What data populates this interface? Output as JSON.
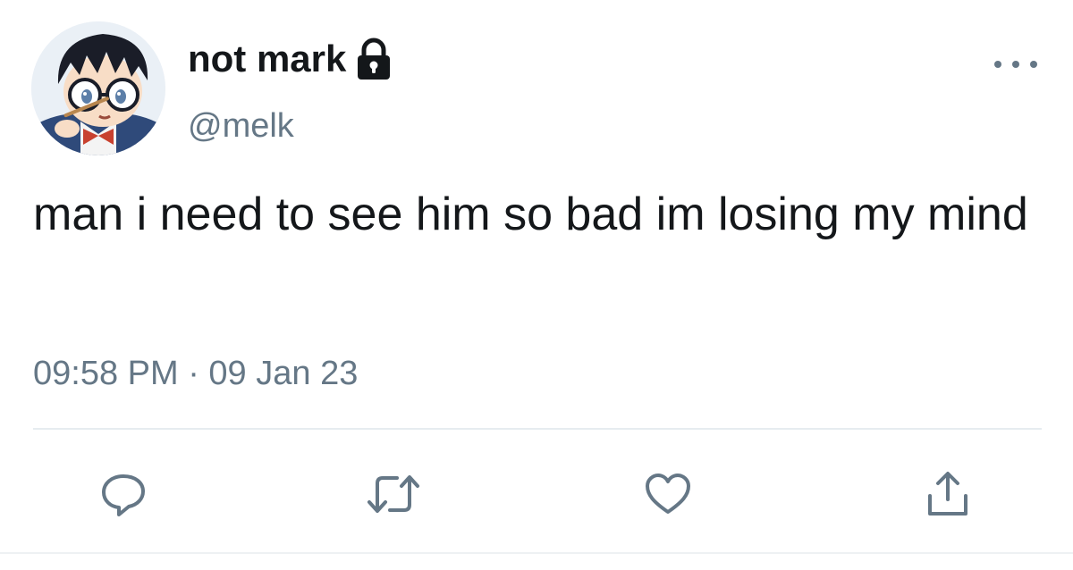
{
  "user": {
    "display_name": "not mark",
    "handle": "@melk",
    "protected_icon": "lock-icon",
    "avatar_icon": "anime-avatar"
  },
  "tweet": {
    "text": "man i need to see him so bad im losing my mind",
    "timestamp": "09:58 PM · 09 Jan 23"
  },
  "actions": [
    {
      "name": "reply",
      "icon": "reply-icon"
    },
    {
      "name": "retweet",
      "icon": "retweet-icon"
    },
    {
      "name": "like",
      "icon": "heart-icon"
    },
    {
      "name": "share",
      "icon": "share-icon"
    }
  ],
  "colors": {
    "text": "#14171a",
    "secondary": "#657786",
    "divider": "#e6ecf0"
  }
}
